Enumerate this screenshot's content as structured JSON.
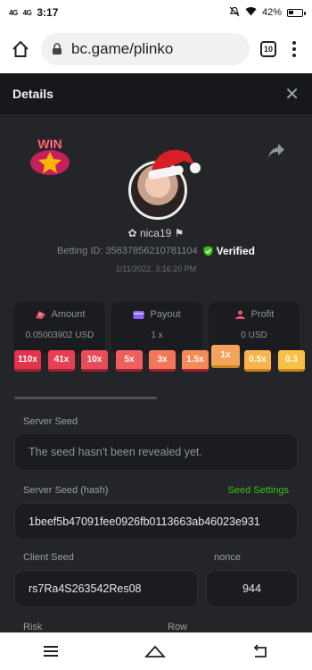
{
  "status": {
    "time": "3:17",
    "network_1": "4G",
    "network_2": "4G",
    "battery": "42%",
    "battery_level": 0.42
  },
  "browser": {
    "url": "bc.game/plinko",
    "tab_count": "10"
  },
  "modal": {
    "title": "Details",
    "close": "✕"
  },
  "win_badge": "WIN",
  "user": {
    "name": "nica19",
    "betting_label": "Betting ID: 356378562107811 04",
    "betting_id": "Betting ID: 356378562107811​04",
    "verified": "Verified",
    "datetime": "1/11/2022, 3:16:20 PM"
  },
  "stats": [
    {
      "label": "Amount",
      "value": "0.05003902 USD",
      "icon": "amount-icon"
    },
    {
      "label": "Payout",
      "value": "1 x",
      "icon": "payout-icon"
    },
    {
      "label": "Profit",
      "value": "0 USD",
      "icon": "profit-icon"
    }
  ],
  "multipliers": [
    "110x",
    "41x",
    "10x",
    "5x",
    "3x",
    "1.5x",
    "1x",
    "0.5x",
    "0.3"
  ],
  "multiplier_colors": [
    "#e3344e",
    "#e83f55",
    "#ea4d5a",
    "#ef5f5d",
    "#f2765a",
    "#f58a57",
    "#f4a35c",
    "#f6b44a",
    "#f6c144"
  ],
  "seeds": {
    "server_seed_label": "Server Seed",
    "server_seed_value": "The seed hasn't been revealed yet.",
    "server_hash_label": "Server Seed (hash)",
    "seed_settings": "Seed Settings",
    "server_hash_value": "1beef5b47091fee0926fb0113663ab46023e931",
    "client_seed_label": "Client Seed",
    "client_seed_value": "rs7Ra4S263542Res08",
    "nonce_label": "nonce",
    "nonce_value": "944",
    "risk_label": "Risk",
    "row_label": "Row"
  },
  "colors": {
    "accent_green": "#3bc117",
    "panel": "#232528",
    "field": "#1a1c1f"
  }
}
